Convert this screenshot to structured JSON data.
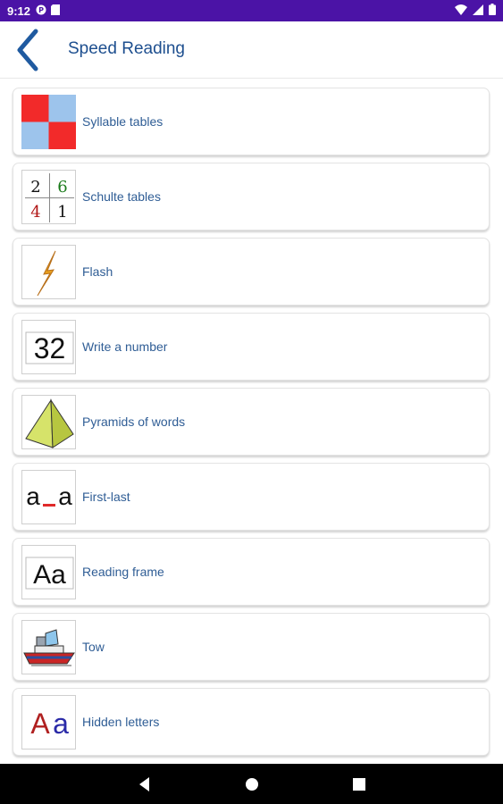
{
  "status_bar": {
    "time": "9:12"
  },
  "app_bar": {
    "title": "Speed Reading"
  },
  "items": [
    {
      "label": "Syllable tables",
      "icon": "syllable-tables-icon"
    },
    {
      "label": "Schulte tables",
      "icon": "schulte-tables-icon",
      "thumb_text": [
        "2",
        "6",
        "4",
        "1"
      ]
    },
    {
      "label": "Flash",
      "icon": "lightning-icon"
    },
    {
      "label": "Write a number",
      "icon": "number-icon",
      "thumb_text": "32"
    },
    {
      "label": "Pyramids of words",
      "icon": "pyramid-icon"
    },
    {
      "label": "First-last",
      "icon": "first-last-icon",
      "thumb_text": [
        "a",
        "a"
      ]
    },
    {
      "label": "Reading frame",
      "icon": "reading-frame-icon",
      "thumb_text": "Aa"
    },
    {
      "label": "Tow",
      "icon": "boat-icon"
    },
    {
      "label": "Hidden letters",
      "icon": "hidden-letters-icon",
      "thumb_text": [
        "A",
        "a"
      ]
    }
  ],
  "colors": {
    "status_bar": "#4b13a6",
    "title": "#1e4f8f",
    "label": "#2f5d95"
  }
}
